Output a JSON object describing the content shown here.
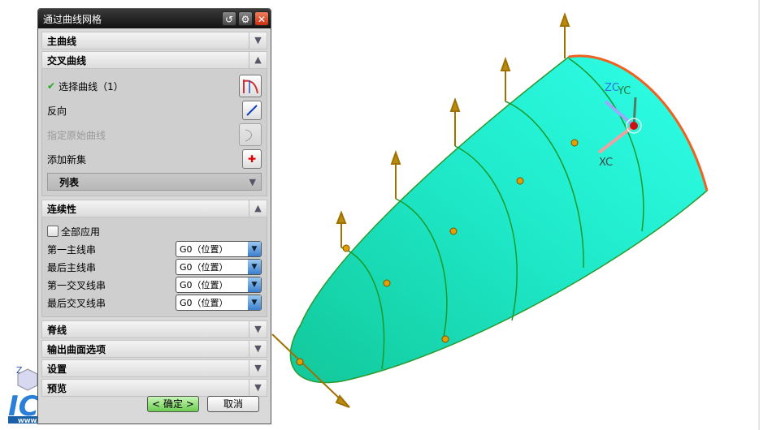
{
  "dialog": {
    "title": "通过曲线网格",
    "title_buttons": {
      "reset": "↺",
      "settings": "⚙",
      "close": "✕"
    },
    "sections": {
      "primary": {
        "label": "主曲线",
        "state": "collapsed"
      },
      "cross": {
        "label": "交叉曲线",
        "state": "expanded",
        "select_curve": "选择曲线（1）",
        "reverse": "反向",
        "specify_origin": "指定原始曲线",
        "add_new_set": "添加新集",
        "list": "列表"
      },
      "continuity": {
        "label": "连续性",
        "state": "expanded",
        "apply_all": "全部应用",
        "rows": [
          {
            "label": "第一主线串",
            "value": "G0（位置）"
          },
          {
            "label": "最后主线串",
            "value": "G0（位置）"
          },
          {
            "label": "第一交叉线串",
            "value": "G0（位置）"
          },
          {
            "label": "最后交叉线串",
            "value": "G0（位置）"
          }
        ]
      },
      "spine": {
        "label": "脊线"
      },
      "output": {
        "label": "输出曲面选项"
      },
      "settings": {
        "label": "设置"
      },
      "preview": {
        "label": "预览"
      }
    },
    "ok": "< 确定 >",
    "cancel": "取消"
  },
  "viewport": {
    "triad": {
      "z": "ZC",
      "y": "YC",
      "x": "XC"
    },
    "logo": "ICAX",
    "logo_url": "WWW.ICAX.ORG",
    "corner_axis": "Z"
  }
}
